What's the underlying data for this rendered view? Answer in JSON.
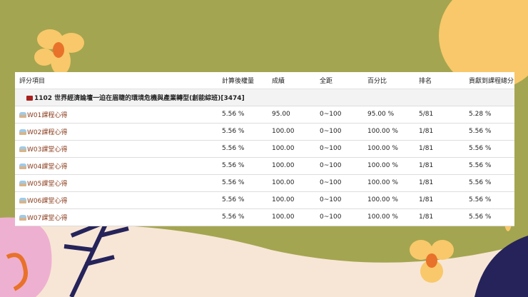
{
  "headers": [
    "評分項目",
    "計算後權量",
    "成績",
    "全距",
    "百分比",
    "排名",
    "貢獻到課程總分"
  ],
  "folder": {
    "label": "1102 世界經濟論壇一迫在眉睫的環境危機與產業轉型(創能綜班)[3474]",
    "icon": "folder-icon"
  },
  "rows": [
    {
      "name": "W01課程心得",
      "weight": "5.56 %",
      "score": "95.00",
      "range": "0~100",
      "percent": "95.00 %",
      "rank": "5/81",
      "contrib": "5.28 %"
    },
    {
      "name": "W02課程心得",
      "weight": "5.56 %",
      "score": "100.00",
      "range": "0~100",
      "percent": "100.00 %",
      "rank": "1/81",
      "contrib": "5.56 %"
    },
    {
      "name": "W03課堂心得",
      "weight": "5.56 %",
      "score": "100.00",
      "range": "0~100",
      "percent": "100.00 %",
      "rank": "1/81",
      "contrib": "5.56 %"
    },
    {
      "name": "W04課堂心得",
      "weight": "5.56 %",
      "score": "100.00",
      "range": "0~100",
      "percent": "100.00 %",
      "rank": "1/81",
      "contrib": "5.56 %"
    },
    {
      "name": "W05課堂心得",
      "weight": "5.56 %",
      "score": "100.00",
      "range": "0~100",
      "percent": "100.00 %",
      "rank": "1/81",
      "contrib": "5.56 %"
    },
    {
      "name": "W06課堂心得",
      "weight": "5.56 %",
      "score": "100.00",
      "range": "0~100",
      "percent": "100.00 %",
      "rank": "1/81",
      "contrib": "5.56 %"
    },
    {
      "name": "W07課堂心得",
      "weight": "5.56 %",
      "score": "100.00",
      "range": "0~100",
      "percent": "100.00 %",
      "rank": "1/81",
      "contrib": "5.56 %"
    }
  ],
  "colors": {
    "background": "#a4a550",
    "item_link": "#8a3b1c",
    "folder": "#a8211e"
  }
}
